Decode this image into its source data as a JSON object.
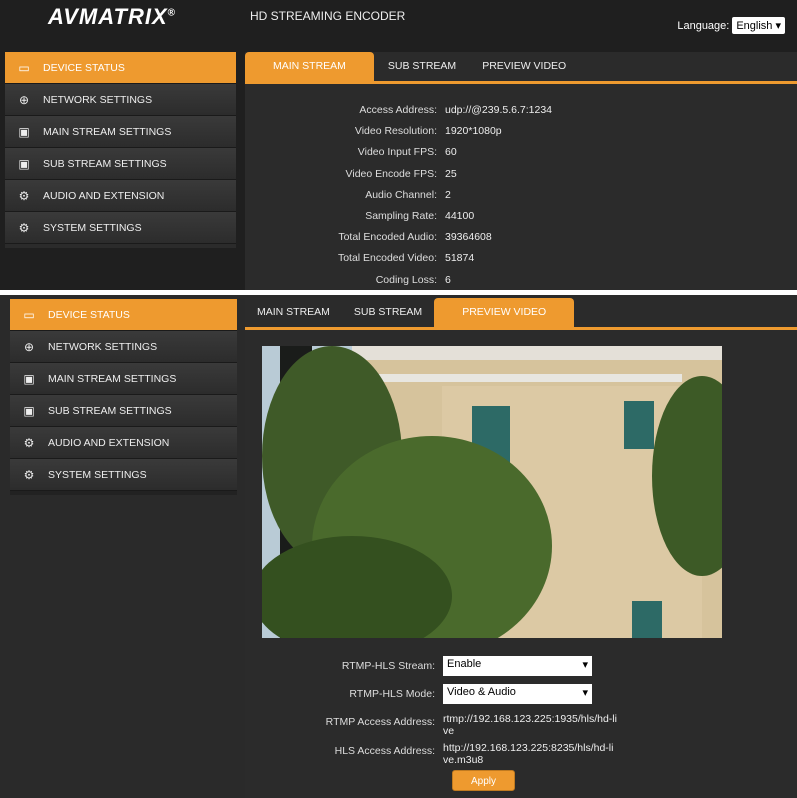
{
  "header": {
    "logo": "AVMATRIX",
    "title": "HD STREAMING ENCODER",
    "language_label": "Language:",
    "language_value": "English"
  },
  "sidebar": {
    "items": [
      {
        "label": "DEVICE STATUS",
        "icon": "monitor-icon"
      },
      {
        "label": "NETWORK SETTINGS",
        "icon": "globe-icon"
      },
      {
        "label": "MAIN STREAM SETTINGS",
        "icon": "stream-icon"
      },
      {
        "label": "SUB STREAM SETTINGS",
        "icon": "stream-icon"
      },
      {
        "label": "AUDIO AND EXTENSION",
        "icon": "gear-dots-icon"
      },
      {
        "label": "SYSTEM SETTINGS",
        "icon": "gear-icon"
      }
    ]
  },
  "tabs": [
    "MAIN STREAM",
    "SUB STREAM",
    "PREVIEW VIDEO"
  ],
  "status": [
    {
      "label": "Access Address:",
      "value": "udp://@239.5.6.7:1234"
    },
    {
      "label": "Video Resolution:",
      "value": "1920*1080p"
    },
    {
      "label": "Video Input FPS:",
      "value": "60"
    },
    {
      "label": "Video Encode FPS:",
      "value": "25"
    },
    {
      "label": "Audio Channel:",
      "value": "2"
    },
    {
      "label": "Sampling Rate:",
      "value": "44100"
    },
    {
      "label": "Total Encoded Audio:",
      "value": "39364608"
    },
    {
      "label": "Total Encoded Video:",
      "value": "51874"
    },
    {
      "label": "Coding Loss:",
      "value": "6"
    }
  ],
  "preview": {
    "stream_label": "RTMP-HLS Stream:",
    "stream_value": "Enable",
    "mode_label": "RTMP-HLS Mode:",
    "mode_value": "Video & Audio",
    "rtmp_label": "RTMP Access Address:",
    "rtmp_value": "rtmp://192.168.123.225:1935/hls/hd-live",
    "hls_label": "HLS Access Address:",
    "hls_value": "http://192.168.123.225:8235/hls/hd-live.m3u8",
    "apply": "Apply"
  }
}
